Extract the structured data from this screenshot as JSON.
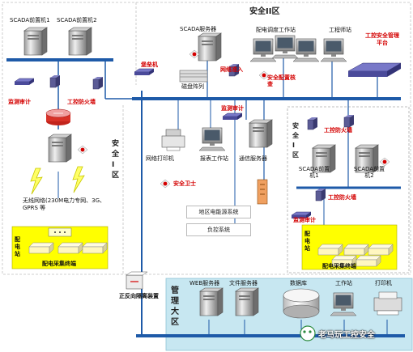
{
  "zones": {
    "zone_ii": "安全II区",
    "zone_i_left": "安全Ⅰ区",
    "zone_i_right": "安全Ⅰ区",
    "mgmt": "管理大区"
  },
  "devices": {
    "scada_pre1": "SCADA前置机1",
    "scada_pre2": "SCADA前置机2",
    "scada_server": "SCADA服务器",
    "dist_dispatch_ws": "配电调度工作站",
    "engineer_ws": "工程师站",
    "ics_mgmt_platform": "工控安全管理平台",
    "fortress": "堡垒机",
    "disk_array": "磁盘阵列",
    "network_access": "网络准入",
    "config_check": "安全配置核查",
    "monitor_audit_ll": "监测审计",
    "firewall_left": "工控防火墙",
    "monitor_audit_mid": "监测审计",
    "network_printer": "网络打印机",
    "report_ws": "报表工作站",
    "comm_server": "通信服务器",
    "security_guard": "安全卫士",
    "regional_power_system": "地区电能源系统",
    "load_control_system": "负控系统",
    "wireless_network": "无线网络(230M电力专网、3G、GPRS 等",
    "dist_station_left": "配电站",
    "dist_terminal_left": "配电采集终端",
    "forward_reverse_isolation": "正反向隔离装置",
    "rz_firewall_top": "工控防火墙",
    "rz_scada_pre1": "SCADA前置机1",
    "rz_scada_pre2": "SCADA前置机2",
    "rz_firewall_bottom": "工控防火墙",
    "rz_monitor_audit": "监测审计",
    "rz_dist_station": "配电站",
    "rz_dist_terminal": "配电采集终端",
    "web_server": "WEB服务器",
    "file_server": "文件服务器",
    "database": "数据库",
    "mgmt_ws": "工作站",
    "mgmt_printer": "打印机"
  },
  "watermark": "老马玩工控安全"
}
